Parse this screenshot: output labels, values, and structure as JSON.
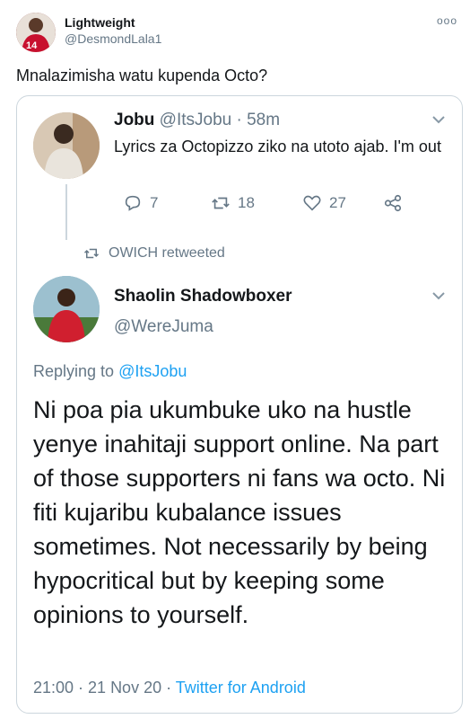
{
  "tweet": {
    "author_name": "Lightweight",
    "author_handle": "@DesmondLala1",
    "more_icon": "ooo",
    "text": "Mnalazimisha watu kupenda Octo?"
  },
  "screenshot": {
    "quoted": {
      "name": "Jobu",
      "handle_time": "@ItsJobu · 58m",
      "text": "Lyrics za Octopizzo ziko na utoto ajab. I'm out",
      "reply_count": "7",
      "retweet_count": "18",
      "like_count": "27"
    },
    "retweet_label": "OWICH retweeted",
    "main": {
      "name": "Shaolin Shadowboxer",
      "handle": "@WereJuma",
      "replying_prefix": "Replying to ",
      "replying_to": "@ItsJobu",
      "text": "Ni poa pia ukumbuke uko na hustle yenye inahitaji support online. Na part of those supporters ni fans wa octo. Ni fiti kujaribu kubalance issues sometimes. Not necessarily by being hypocritical but by keeping some opinions to yourself.",
      "timestamp": "21:00 · 21 Nov 20 · ",
      "source": "Twitter for Android"
    },
    "colors": {
      "accent": "#1da1f2",
      "muted": "#657786",
      "text": "#14171a",
      "border": "#ccd6dd"
    }
  }
}
